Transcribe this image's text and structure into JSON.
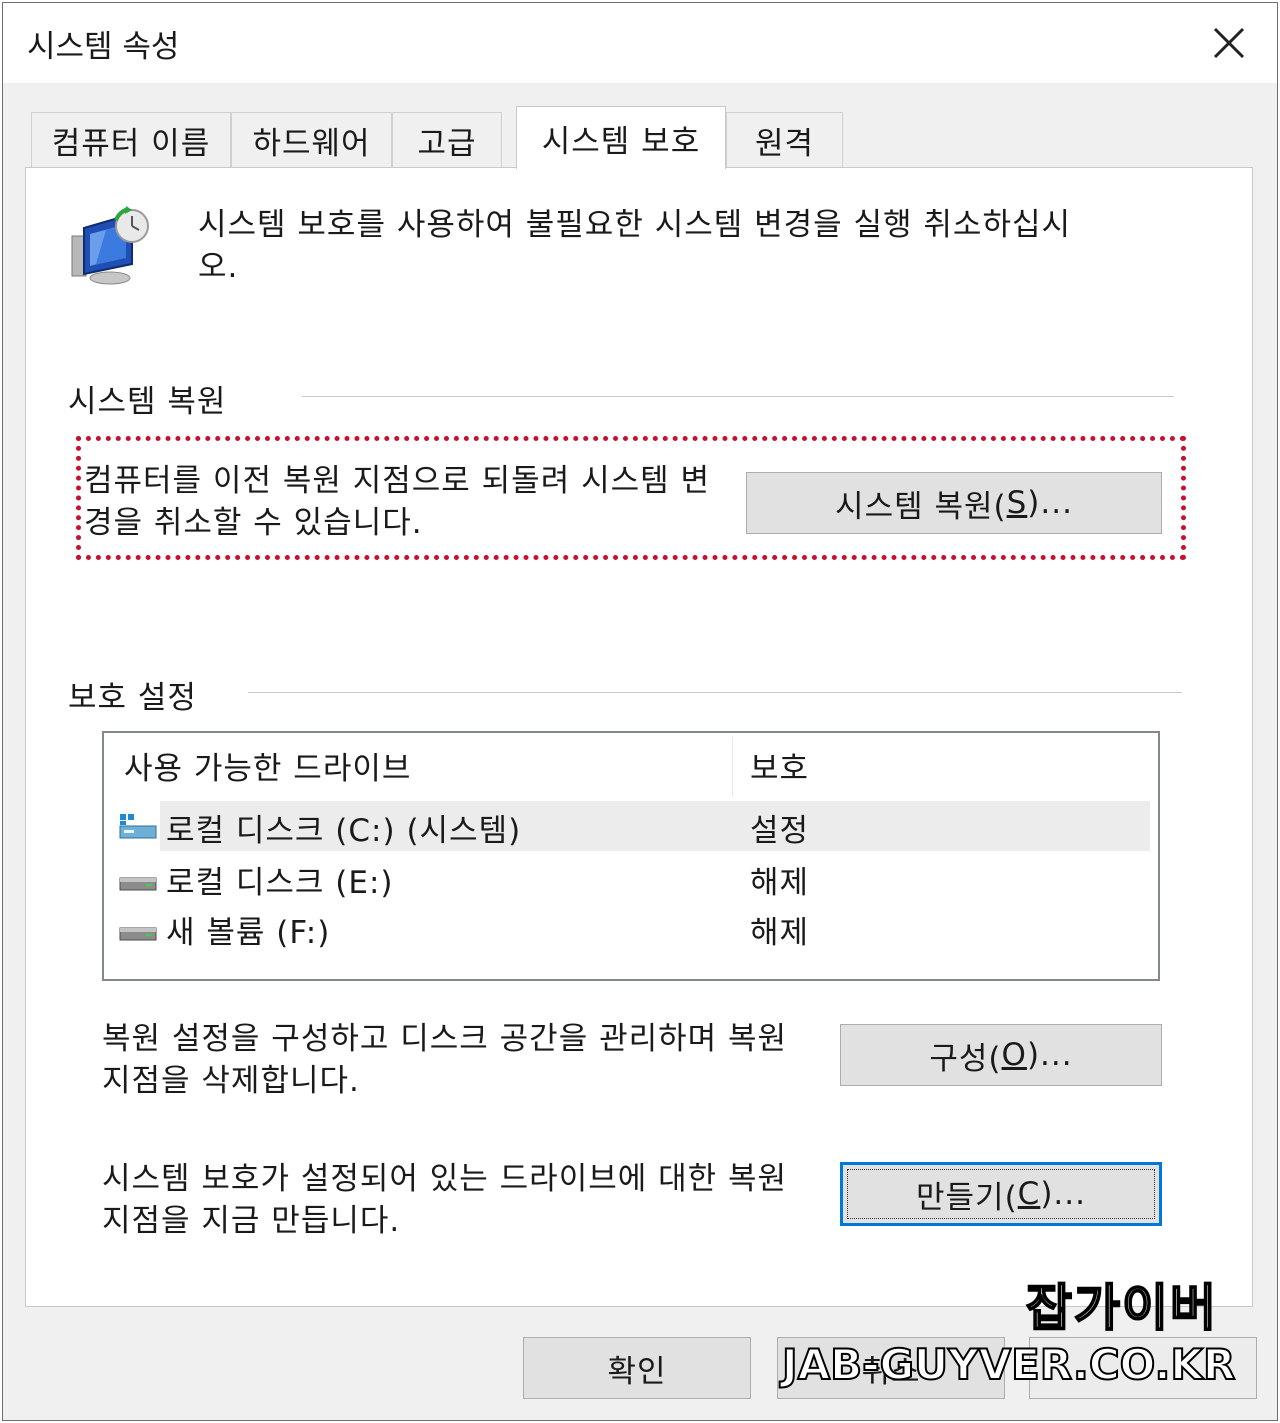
{
  "window": {
    "title": "시스템 속성"
  },
  "tabs": [
    {
      "label": "컴퓨터 이름"
    },
    {
      "label": "하드웨어"
    },
    {
      "label": "고급"
    },
    {
      "label": "시스템 보호"
    },
    {
      "label": "원격"
    }
  ],
  "active_tab": "시스템 보호",
  "intro": {
    "text": "시스템 보호를 사용하여 불필요한 시스템 변경을 실행 취소하십시오."
  },
  "system_restore": {
    "group_label": "시스템 복원",
    "description": "컴퓨터를 이전 복원 지점으로 되돌려 시스템 변경을 취소할 수 있습니다.",
    "button_prefix": "시스템 복원(",
    "button_key": "S",
    "button_suffix": ")..."
  },
  "protection": {
    "group_label": "보호 설정",
    "col_drive": "사용 가능한 드라이브",
    "col_protection": "보호",
    "drives": [
      {
        "name": "로컬 디스크 (C:) (시스템)",
        "status": "설정",
        "type": "system-drive-icon",
        "selected": true
      },
      {
        "name": "로컬 디스크 (E:)",
        "status": "해제",
        "type": "drive-icon",
        "selected": false
      },
      {
        "name": "새 볼륨 (F:)",
        "status": "해제",
        "type": "drive-icon",
        "selected": false
      }
    ]
  },
  "configure": {
    "description": "복원 설정을 구성하고 디스크 공간을 관리하며 복원 지점을 삭제합니다.",
    "button_prefix": "구성(",
    "button_key": "O",
    "button_suffix": ")..."
  },
  "create": {
    "description": "시스템 보호가 설정되어 있는 드라이브에 대한 복원 지점을 지금 만듭니다.",
    "button_prefix": "만들기(",
    "button_key": "C",
    "button_suffix": ")..."
  },
  "footer": {
    "ok_label": "확인",
    "cancel_label": "취소"
  },
  "watermark": {
    "korean": "잡가이버",
    "domain": "JAB-GUYVER.CO.KR"
  },
  "colors": {
    "highlight_dotted": "#c8102e",
    "default_button_border": "#0078d7"
  }
}
